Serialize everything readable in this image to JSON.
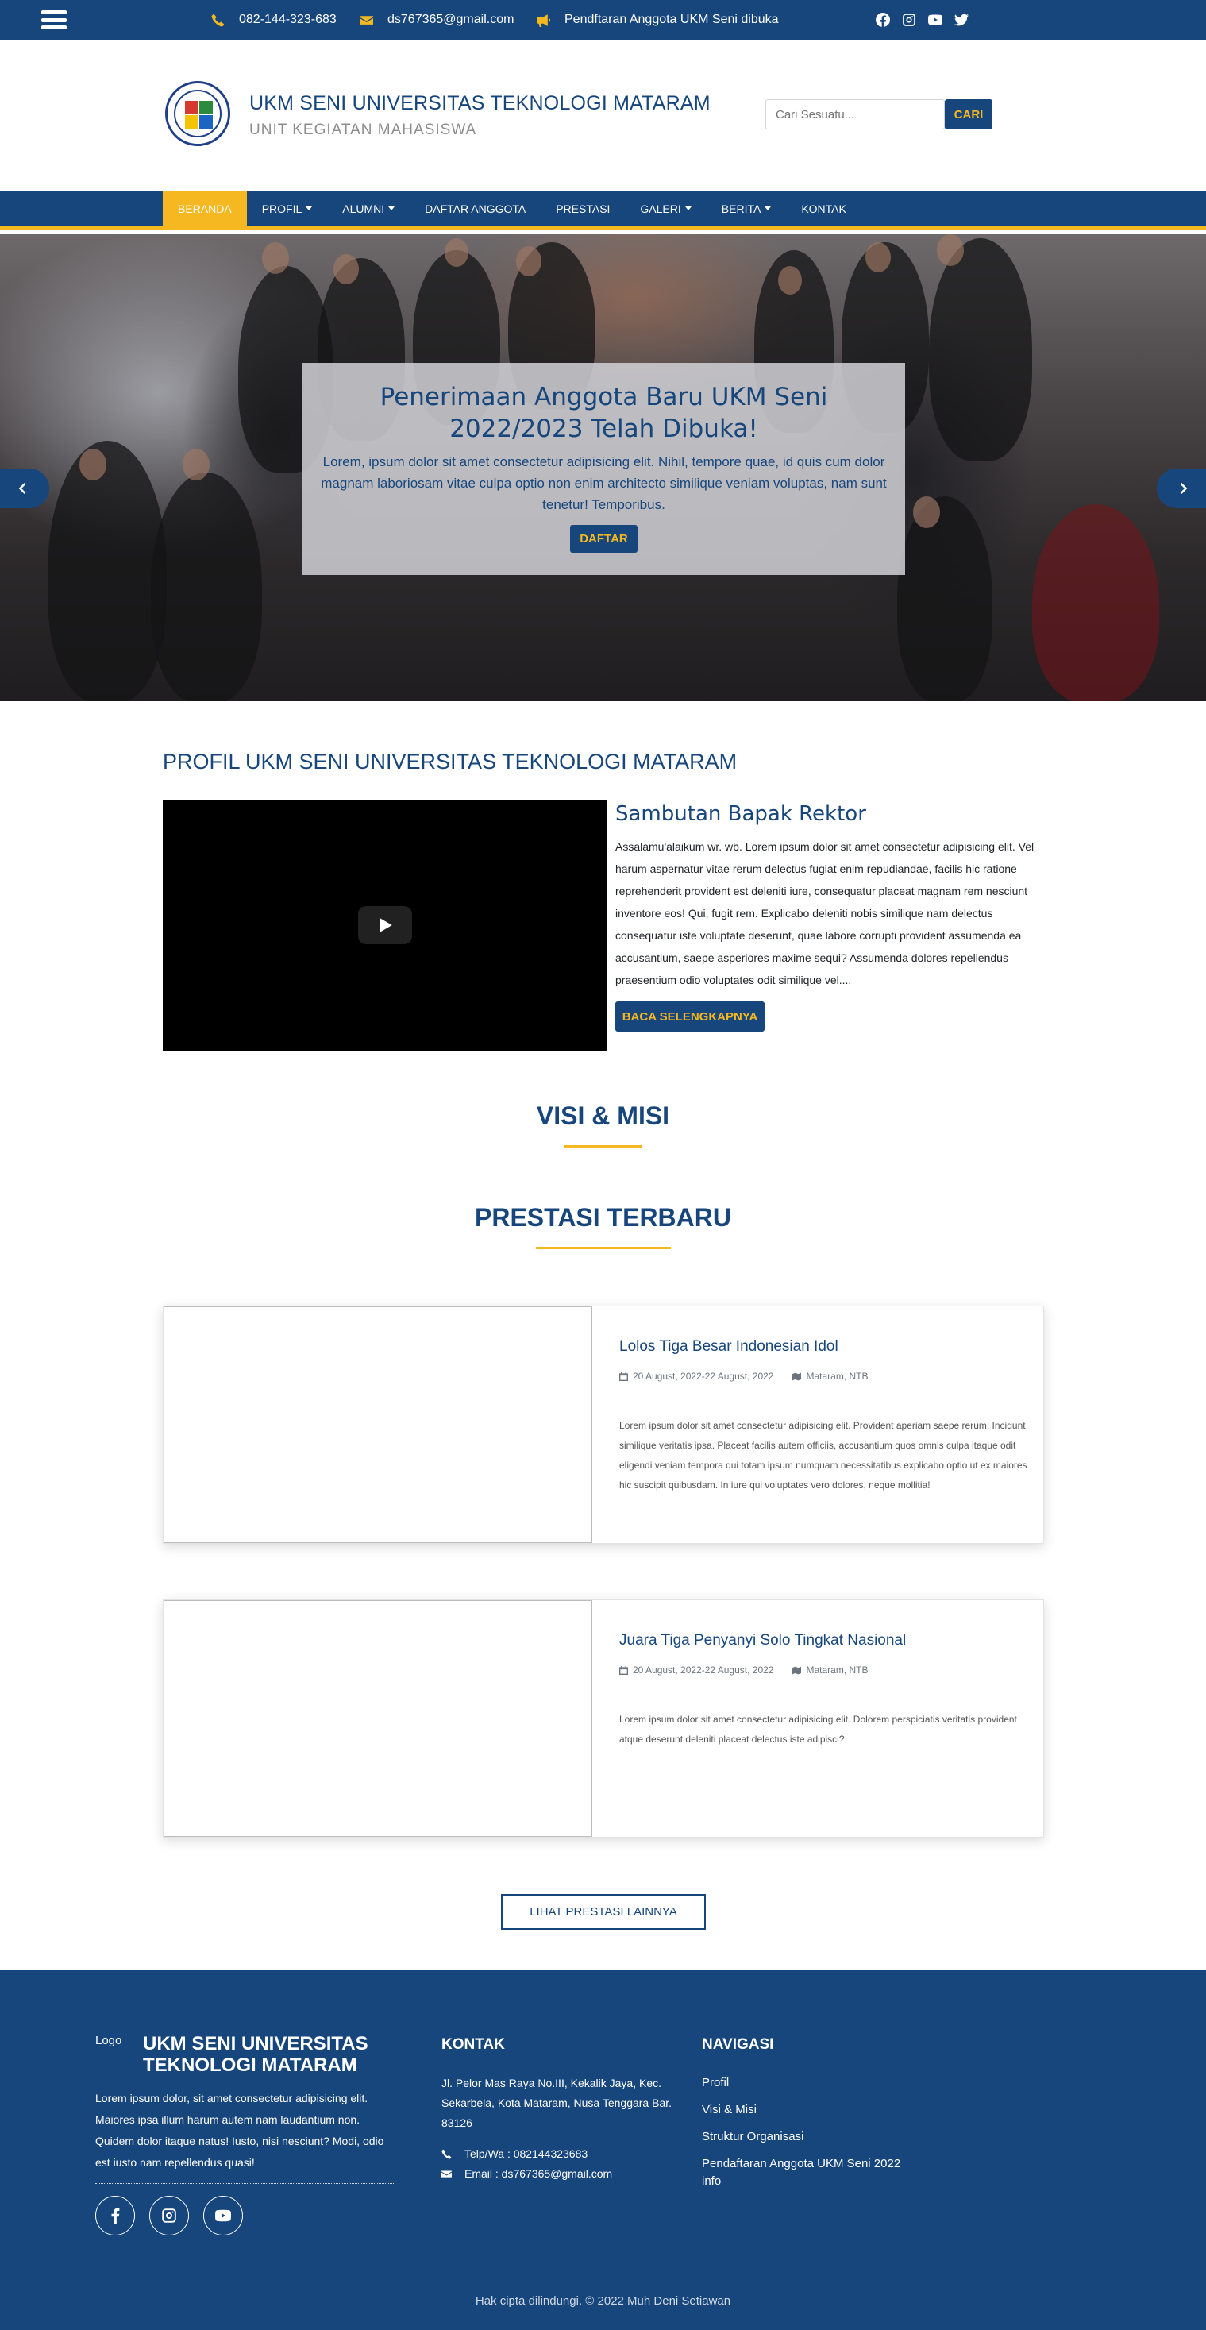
{
  "topbar": {
    "phone": "082-144-323-683",
    "email": "ds767365@gmail.com",
    "announcement": "Pendftaran Anggota UKM Seni dibuka",
    "social_icons": [
      "facebook-icon",
      "instagram-icon",
      "youtube-icon",
      "twitter-icon"
    ]
  },
  "header": {
    "title": "UKM SENI UNIVERSITAS TEKNOLOGI MATARAM",
    "subtitle": "UNIT KEGIATAN MAHASISWA",
    "search_placeholder": "Cari Sesuatu...",
    "search_button": "CARI"
  },
  "nav": {
    "items": [
      {
        "label": "BERANDA",
        "active": true
      },
      {
        "label": "PROFIL"
      },
      {
        "label": "ALUMNI"
      },
      {
        "label": "DAFTAR ANGGOTA"
      },
      {
        "label": "PRESTASI"
      },
      {
        "label": "GALERI"
      },
      {
        "label": "BERITA"
      },
      {
        "label": "KONTAK"
      }
    ]
  },
  "hero": {
    "title": "Penerimaan Anggota Baru UKM Seni 2022/2023 Telah Dibuka!",
    "text": "Lorem, ipsum dolor sit amet consectetur adipisicing elit. Nihil, tempore quae, id quis cum dolor magnam laboriosam vitae culpa optio non enim architecto similique veniam voluptas, nam sunt tenetur! Temporibus.",
    "button": "DAFTAR"
  },
  "profile": {
    "heading": "PROFIL UKM SENI UNIVERSITAS TEKNOLOGI MATARAM",
    "welcome_title": "Sambutan Bapak Rektor",
    "welcome_text": "Assalamu'alaikum wr. wb. Lorem ipsum dolor sit amet consectetur adipisicing elit. Vel harum aspernatur vitae rerum delectus fugiat enim repudiandae, facilis hic ratione reprehenderit provident est deleniti iure, consequatur placeat magnam rem nesciunt inventore eos! Qui, fugit rem. Explicabo deleniti nobis similique nam delectus consequatur iste voluptate deserunt, quae labore corrupti provident assumenda ea accusantium, saepe asperiores maxime sequi? Assumenda dolores repellendus praesentium odio voluptates odit similique vel....",
    "read_more": "BACA SELENGKAPNYA"
  },
  "visi_misi": {
    "heading": "VISI & MISI"
  },
  "prestasi": {
    "heading": "PRESTASI TERBARU",
    "cards": [
      {
        "title": "Lolos Tiga Besar Indonesian Idol",
        "date": "20 August, 2022-22 August, 2022",
        "location": "Mataram, NTB",
        "text": "Lorem ipsum dolor sit amet consectetur adipisicing elit. Provident aperiam saepe rerum! Incidunt similique veritatis ipsa. Placeat facilis autem officiis, accusantium quos omnis culpa itaque odit eligendi veniam tempora qui totam ipsum numquam necessitatibus explicabo optio ut ex maiores hic suscipit quibusdam. In iure qui voluptates vero dolores, neque mollitia!"
      },
      {
        "title": "Juara Tiga Penyanyi Solo Tingkat Nasional",
        "date": "20 August, 2022-22 August, 2022",
        "location": "Mataram, NTB",
        "text": "Lorem ipsum dolor sit amet consectetur adipisicing elit. Dolorem perspiciatis veritatis provident atque deserunt deleniti placeat delectus iste adipisci?"
      }
    ],
    "more_button": "LIHAT PRESTASI LAINNYA"
  },
  "footer": {
    "logo_alt": "Logo",
    "title": "UKM SENI UNIVERSITAS TEKNOLOGI MATARAM",
    "description": "Lorem ipsum dolor, sit amet consectetur adipisicing elit. Maiores ipsa illum harum autem nam laudantium non. Quidem dolor itaque natus! Iusto, nisi nesciunt? Modi, odio est iusto nam repellendus quasi!",
    "contact_heading": "KONTAK",
    "address": "Jl. Pelor Mas Raya No.III, Kekalik Jaya, Kec. Sekarbela, Kota Mataram, Nusa Tenggara Bar. 83126",
    "phone": "Telp/Wa : 082144323683",
    "email": "Email : ds767365@gmail.com",
    "nav_heading": "NAVIGASI",
    "nav_items": [
      "Profil",
      "Visi & Misi",
      "Struktur Organisasi",
      "Pendaftaran Anggota UKM Seni 2022",
      "info"
    ],
    "copyright": "Hak cipta dilindungi. © 2022 Muh Deni Setiawan"
  },
  "colors": {
    "primary": "#17467c",
    "accent": "#f6b820"
  }
}
